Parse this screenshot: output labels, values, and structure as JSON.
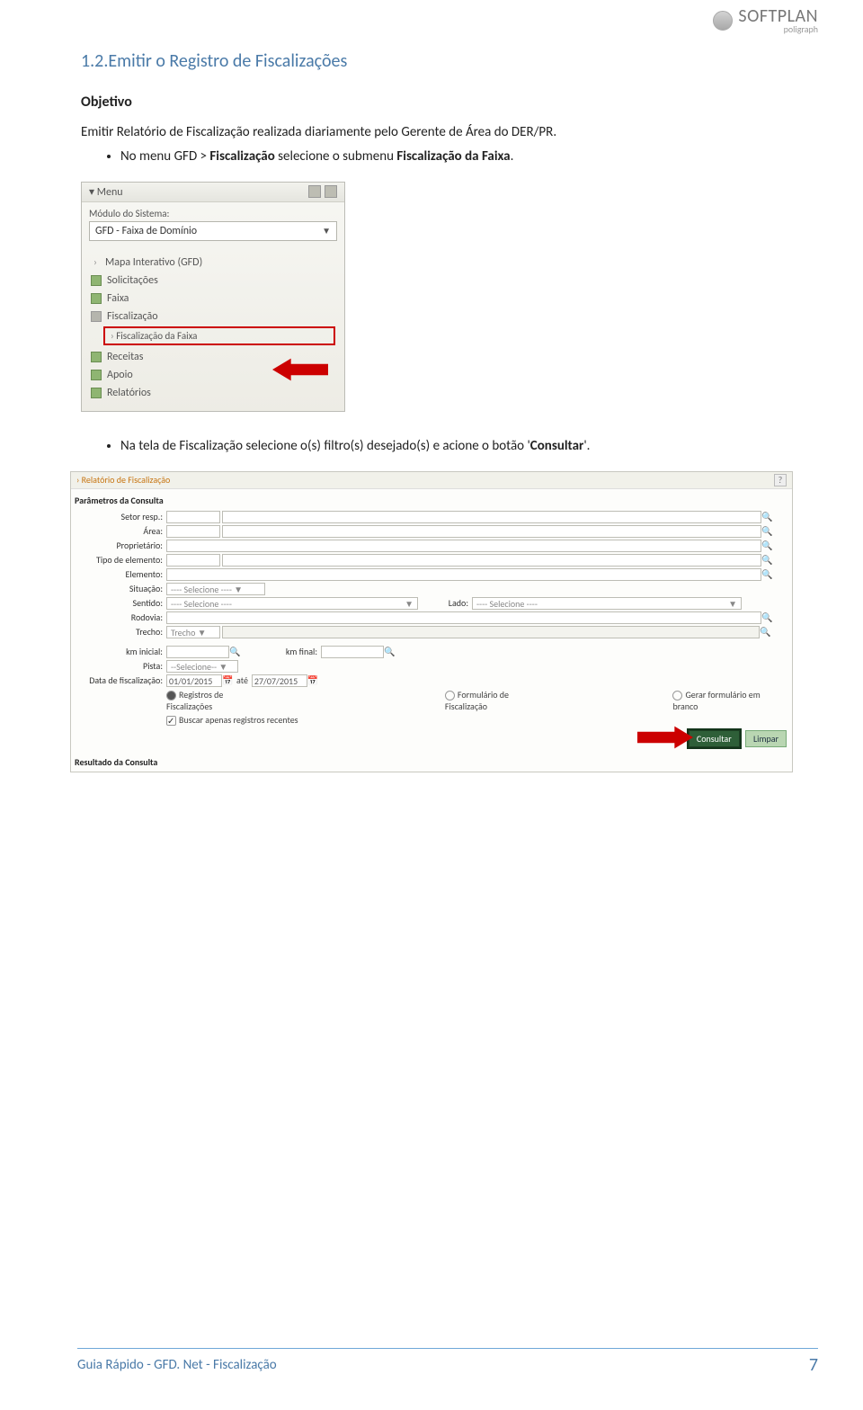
{
  "logo": {
    "brand": "SOFTPLAN",
    "sub": "poligraph"
  },
  "heading": "1.2.Emitir o Registro de Fiscalizações",
  "objetivo_label": "Objetivo",
  "para1": "Emitir Relatório de Fiscalização realizada diariamente pelo Gerente de Área do DER/PR.",
  "bullet1_pre": "No menu GFD > ",
  "bullet1_b1": "Fiscalização",
  "bullet1_mid": " selecione o submenu ",
  "bullet1_b2": "Fiscalização da Faixa",
  "bullet1_post": ".",
  "menu": {
    "title": "Menu",
    "module_label": "Módulo do Sistema:",
    "module_value": "GFD - Faixa de Domínio",
    "items": {
      "mapa": "Mapa Interativo (GFD)",
      "solic": "Solicitações",
      "faixa": "Faixa",
      "fisc": "Fiscalização",
      "fisc_sub": "Fiscalização da Faixa",
      "receitas": "Receitas",
      "apoio": "Apoio",
      "relat": "Relatórios"
    }
  },
  "bullet2_pre": "Na tela de Fiscalização selecione o(s) filtro(s) desejado(s) e acione o botão '",
  "bullet2_b": "Consultar",
  "bullet2_post": "'.",
  "form": {
    "breadcrumb": "Relatório de Fiscalização",
    "section1": "Parâmetros da Consulta",
    "labels": {
      "setor": "Setor resp.:",
      "area": "Área:",
      "prop": "Proprietário:",
      "tipoelem": "Tipo de elemento:",
      "elemento": "Elemento:",
      "situacao": "Situação:",
      "sentido": "Sentido:",
      "lado": "Lado:",
      "rodovia": "Rodovia:",
      "trecho": "Trecho:",
      "trecho_val": "Trecho",
      "kmini": "km inicial:",
      "kmfin": "km final:",
      "pista": "Pista:",
      "datafisc": "Data de fiscalização:",
      "date1": "01/01/2015",
      "ate": "até",
      "date2": "27/07/2015",
      "sel_placeholder": "---- Selecione ----",
      "sel_placeholder2": "--Selecione--",
      "r_reg": "Registros de Fiscalizações",
      "r_form": "Formulário de Fiscalização",
      "r_gera": "Gerar formulário em branco",
      "chk_recent": "Buscar apenas registros recentes"
    },
    "btn_consultar": "Consultar",
    "btn_limpar": "Limpar",
    "section2": "Resultado da Consulta"
  },
  "footer": {
    "text": "Guia Rápido - GFD. Net - Fiscalização",
    "page": "7"
  }
}
